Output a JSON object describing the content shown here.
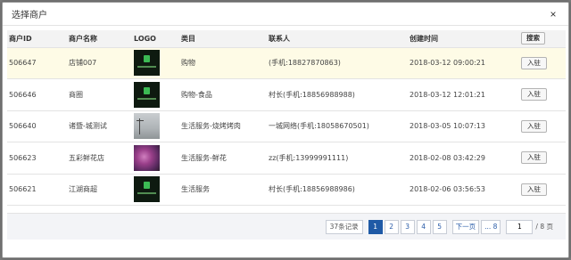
{
  "dialog": {
    "title": "选择商户",
    "close_glyph": "×"
  },
  "table": {
    "headers": {
      "id": "商户ID",
      "name": "商户名称",
      "logo": "LOGO",
      "category": "类目",
      "contact": "联系人",
      "created": "创建时间"
    },
    "search_label": "搜索",
    "rows": [
      {
        "id": "506647",
        "name": "店铺007",
        "logo": "dark",
        "category": "购物",
        "contact": "(手机:18827870863)",
        "created": "2018-03-12 09:00:21",
        "action": "入驻"
      },
      {
        "id": "506646",
        "name": "商圈",
        "logo": "dark",
        "category": "购物-食品",
        "contact": "村长(手机:18856988988)",
        "created": "2018-03-12 12:01:21",
        "action": "入驻"
      },
      {
        "id": "506640",
        "name": "诸暨-城测试",
        "logo": "gray",
        "category": "生活服务-烧烤烤肉",
        "contact": "一城网络(手机:18058670501)",
        "created": "2018-03-05 10:07:13",
        "action": "入驻"
      },
      {
        "id": "506623",
        "name": "五彩鲜花店",
        "logo": "flower",
        "category": "生活服务-鲜花",
        "contact": "zz(手机:13999991111)",
        "created": "2018-02-08 03:42:29",
        "action": "入驻"
      },
      {
        "id": "506621",
        "name": "江湖商超",
        "logo": "dark",
        "category": "生活服务",
        "contact": "村长(手机:18856988986)",
        "created": "2018-02-06 03:56:53",
        "action": "入驻"
      }
    ]
  },
  "pagination": {
    "records": "37条记录",
    "pages": [
      "1",
      "2",
      "3",
      "4",
      "5"
    ],
    "active_page": "1",
    "next": "下一页",
    "last": "... 8",
    "input_value": "1",
    "total": "/ 8 页"
  }
}
